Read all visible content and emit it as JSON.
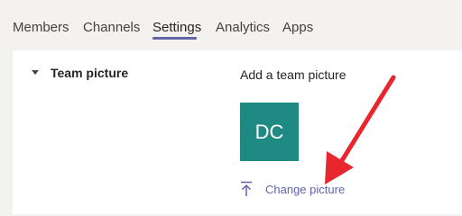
{
  "tabs": [
    {
      "label": "Members"
    },
    {
      "label": "Channels"
    },
    {
      "label": "Settings"
    },
    {
      "label": "Analytics"
    },
    {
      "label": "Apps"
    }
  ],
  "active_tab": "Settings",
  "section": {
    "title": "Team picture",
    "description": "Add a team picture",
    "avatar_initials": "DC",
    "avatar_color": "#1f8a84",
    "change_label": "Change picture",
    "link_color": "#6264a7"
  },
  "annotation": {
    "arrow_color": "#e8262d"
  },
  "icons": {
    "section_toggle": "chevron-down-icon",
    "change_picture": "upload-icon"
  }
}
